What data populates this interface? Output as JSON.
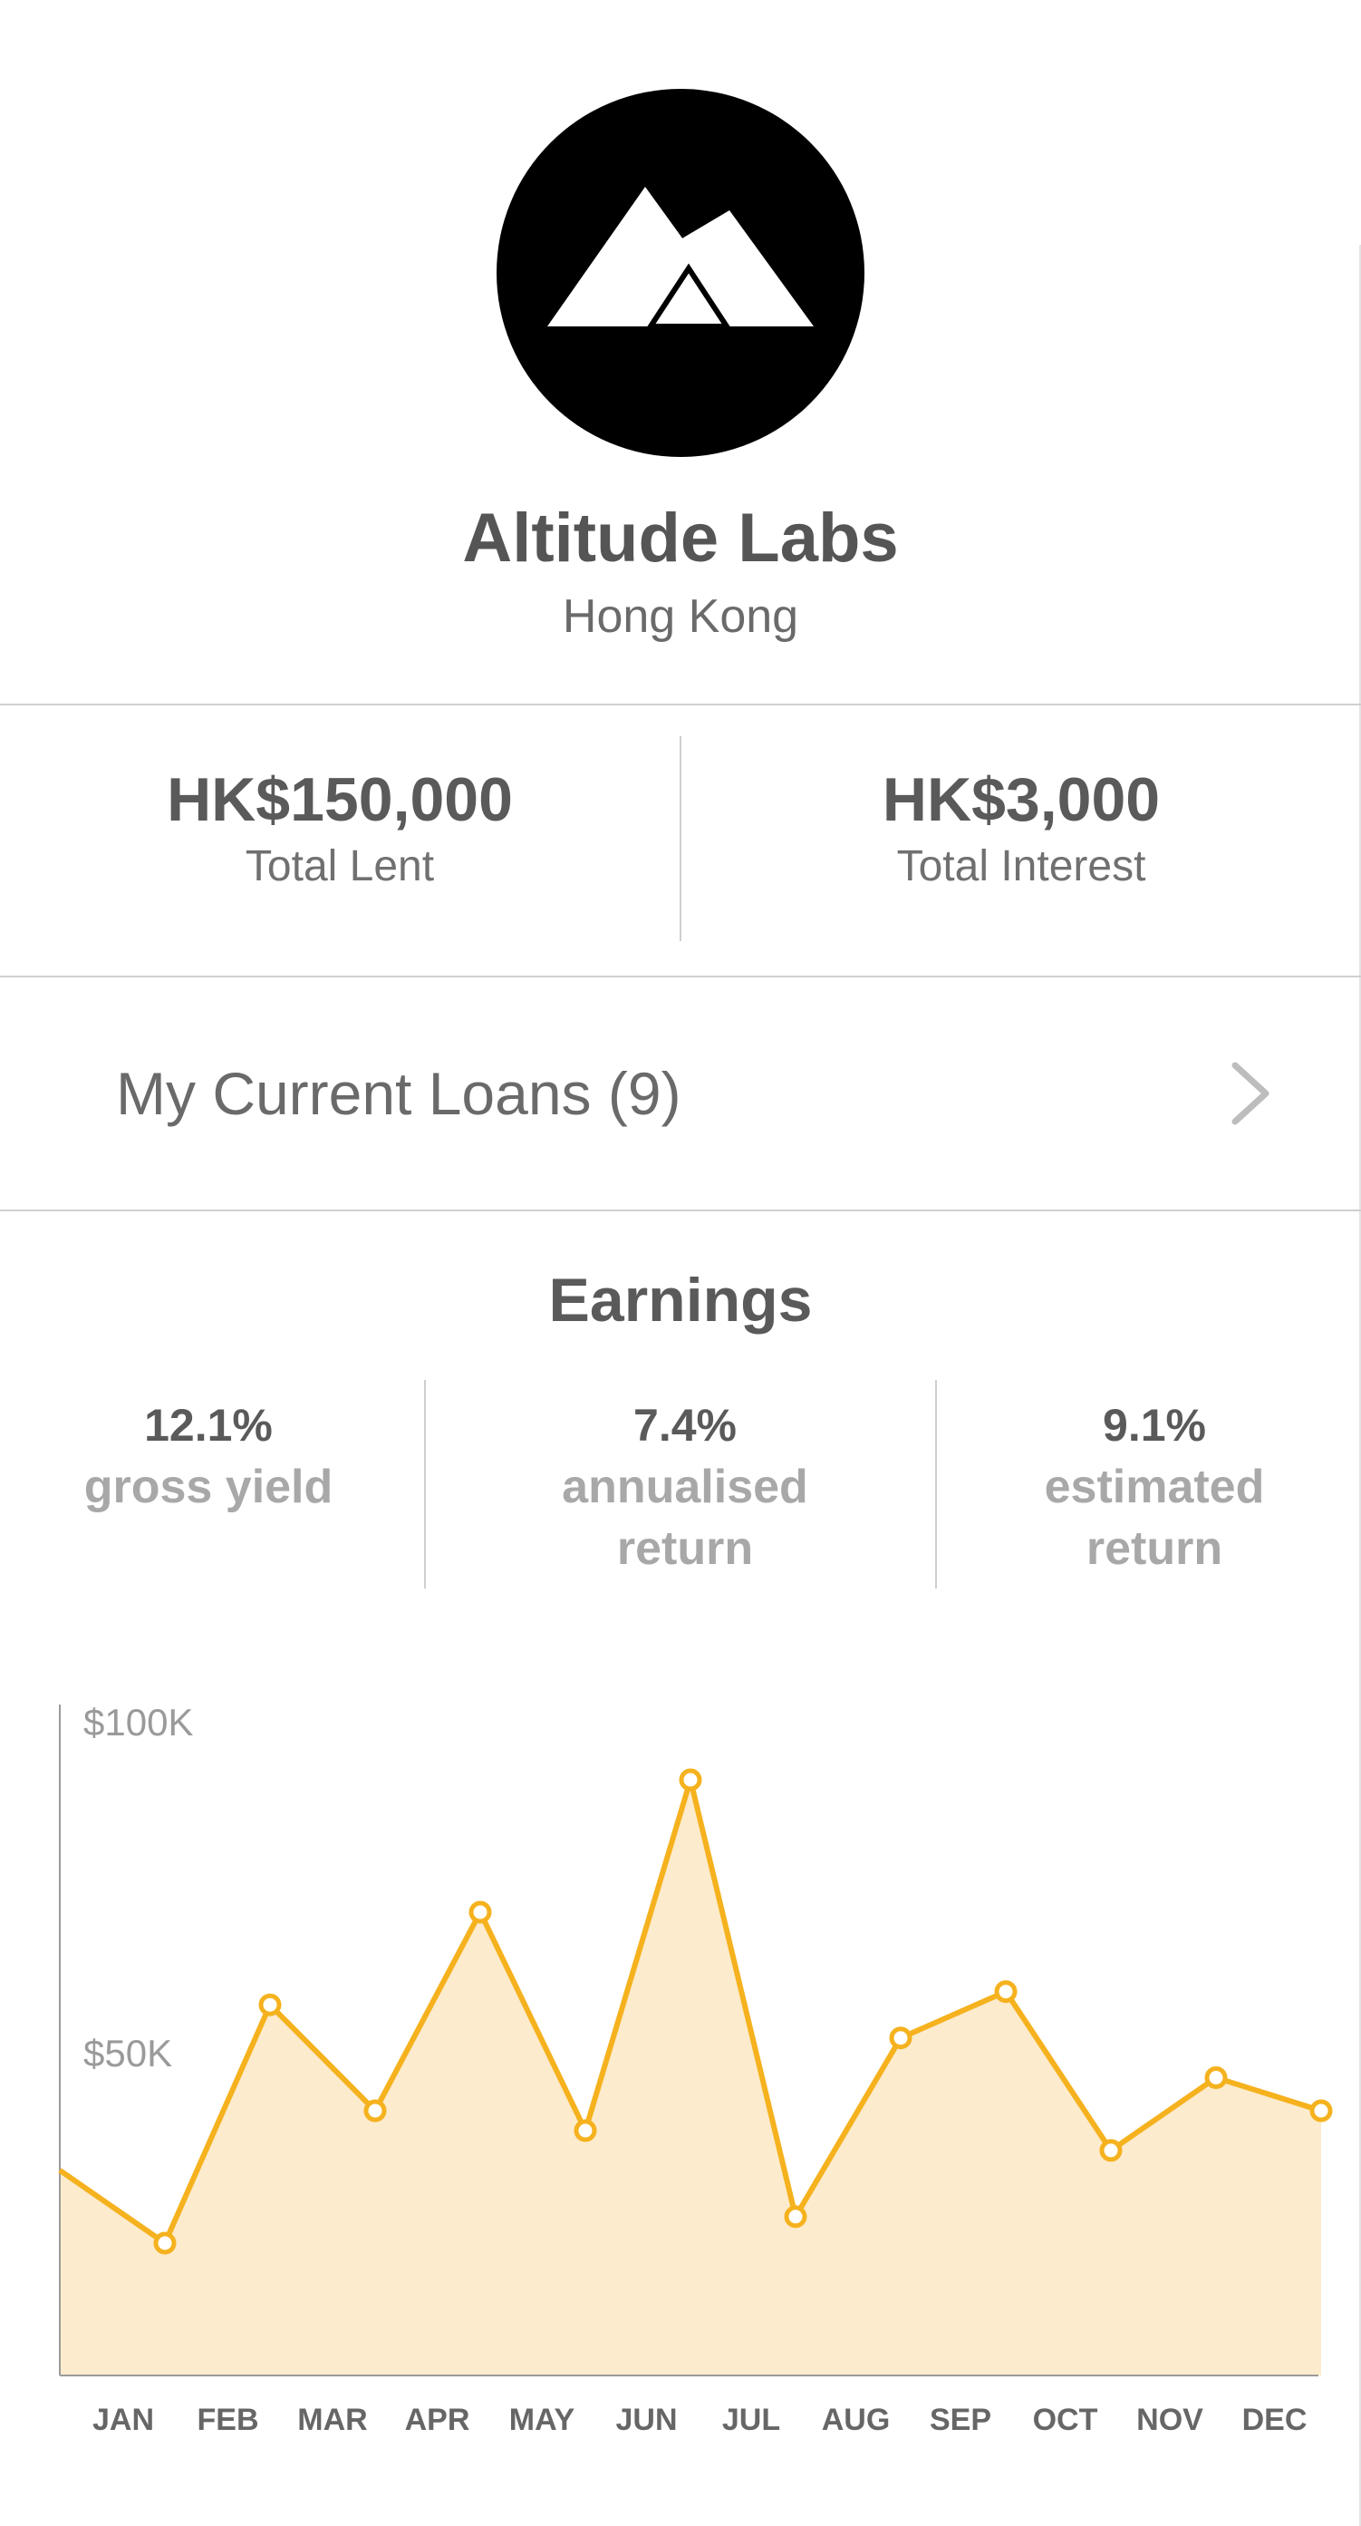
{
  "profile": {
    "logo_icon": "mountain-logo-icon",
    "name": "Altitude Labs",
    "location": "Hong Kong"
  },
  "totals": {
    "lent": {
      "value": "HK$150,000",
      "label": "Total Lent"
    },
    "interest": {
      "value": "HK$3,000",
      "label": "Total Interest"
    }
  },
  "loans": {
    "label": "My Current Loans (9)",
    "icon": "chevron-right-icon"
  },
  "earnings": {
    "title": "Earnings",
    "metrics": [
      {
        "value": "12.1%",
        "label": "gross yield"
      },
      {
        "value": "7.4%",
        "label": "annualised return"
      },
      {
        "value": "9.1%",
        "label": "estimated return"
      }
    ]
  },
  "colors": {
    "line": "#f5b21e",
    "area": "#fcebcc",
    "axis": "#9a9a9a"
  },
  "chart_data": {
    "type": "area",
    "categories": [
      "JAN",
      "FEB",
      "MAR",
      "APR",
      "MAY",
      "JUN",
      "JUL",
      "AUG",
      "SEP",
      "OCT",
      "NOV",
      "DEC"
    ],
    "y_ticks": [
      "$100K",
      "$50K"
    ],
    "y_tick_values": [
      100,
      50
    ],
    "ylim": [
      0,
      100
    ],
    "start_value": 31,
    "values": [
      20,
      56,
      40,
      70,
      37,
      90,
      24,
      51,
      58,
      34,
      45,
      40
    ],
    "grid": false,
    "markers": true
  }
}
